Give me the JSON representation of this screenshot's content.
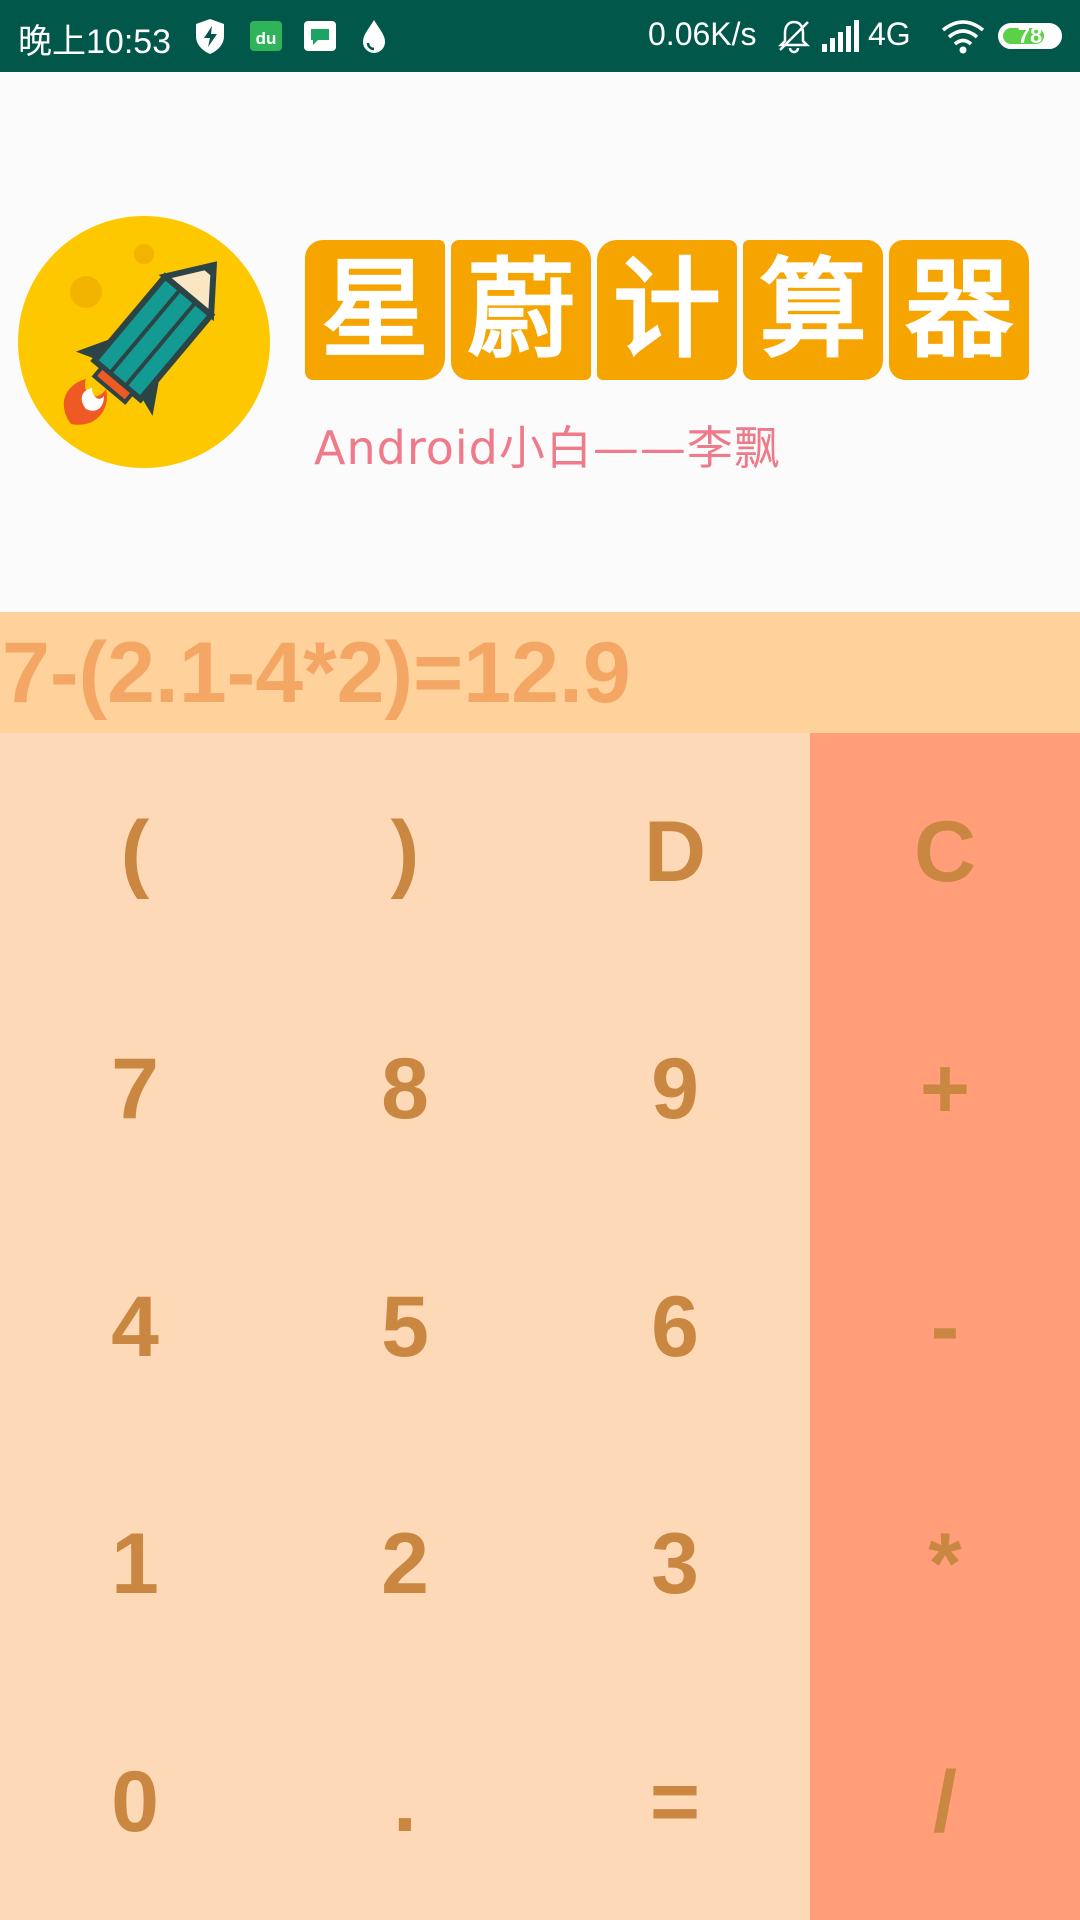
{
  "status_bar": {
    "time": "晚上10:53",
    "network_speed": "0.06K/s",
    "network_type": "4G",
    "battery_level": "78",
    "battery_fraction": 0.78,
    "icons": [
      "shield-icon",
      "du-app-icon",
      "message-app-icon",
      "water-drop-icon",
      "mute-bell-icon",
      "signal-icon",
      "wifi-icon",
      "battery-icon"
    ]
  },
  "banner": {
    "title_chars": [
      "星",
      "蔚",
      "计",
      "算",
      "器"
    ],
    "subtitle": "Android小白——李飘",
    "logo_icon": "rocket-logo-icon",
    "colors": {
      "title_bg": "#f6a400",
      "logo_ring": "#fdc800",
      "subtitle": "#ef7a8a"
    }
  },
  "display": {
    "expression": "7-(2.1-4*2)=12.9"
  },
  "keys": {
    "row1": [
      "(",
      ")",
      "D",
      "C"
    ],
    "row2": [
      "7",
      "8",
      "9",
      "+"
    ],
    "row3": [
      "4",
      "5",
      "6",
      "-"
    ],
    "row4": [
      "1",
      "2",
      "3",
      "*"
    ],
    "row5": [
      "0",
      ".",
      "=",
      "/"
    ]
  },
  "colors": {
    "status_bar": "#01584a",
    "display_bg": "#ffd29c",
    "display_text": "#f4a664",
    "keypad_bg": "#fed9b7",
    "operator_column": "#ff9e78",
    "key_text": "#ca8741"
  }
}
